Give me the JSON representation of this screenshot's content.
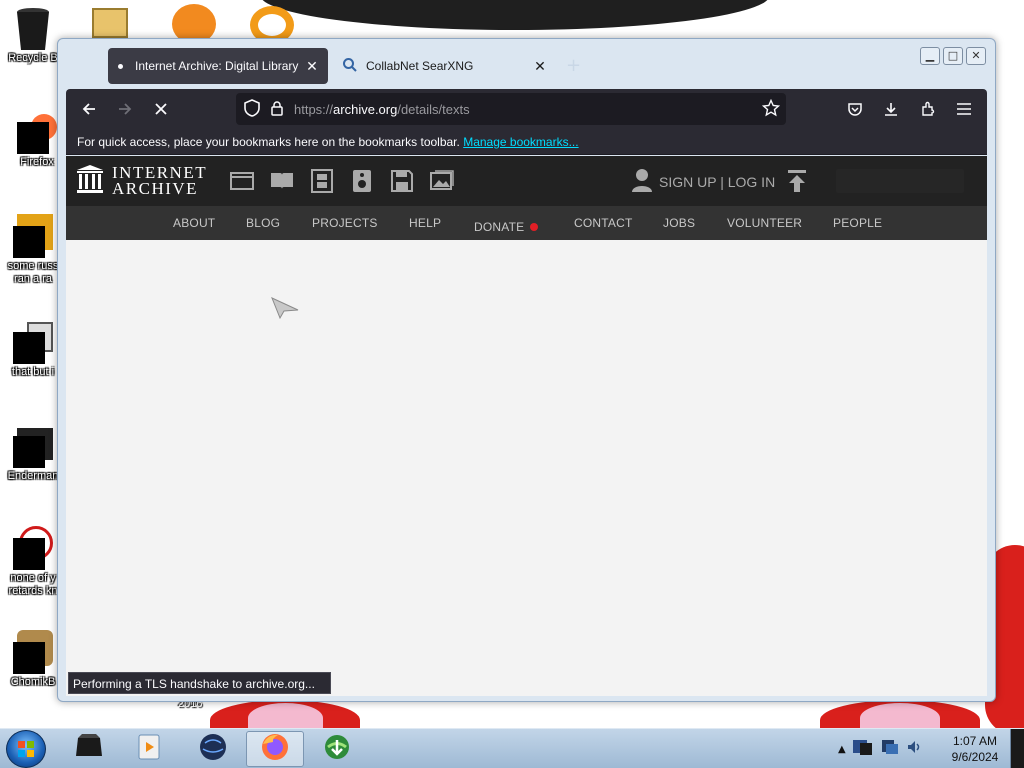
{
  "desktop": {
    "icons": [
      {
        "label": "Recycle B"
      },
      {
        "label": "Firefox"
      },
      {
        "label": "some russ\nran a ra"
      },
      {
        "label": "that but i"
      },
      {
        "label": "Enderman"
      },
      {
        "label": "none of y\nretards kn"
      },
      {
        "label": "ChomikB"
      }
    ],
    "bottom_text": "2016"
  },
  "tabs": [
    {
      "title": "Internet Archive: Digital Library",
      "active": true
    },
    {
      "title": "CollabNet SearXNG",
      "active": false
    }
  ],
  "toolbar": {
    "url_protocol": "https://",
    "url_host": "archive.org",
    "url_path": "/details/texts"
  },
  "bookmarks_bar": {
    "text": "For quick access, place your bookmarks here on the bookmarks toolbar.",
    "link": "Manage bookmarks..."
  },
  "ia": {
    "logo_line1": "INTERNET",
    "logo_line2": "ARCHIVE",
    "auth": "SIGN UP | LOG IN",
    "nav": [
      "ABOUT",
      "BLOG",
      "PROJECTS",
      "HELP",
      "DONATE",
      "CONTACT",
      "JOBS",
      "VOLUNTEER",
      "PEOPLE"
    ]
  },
  "status": "Performing a TLS handshake to archive.org...",
  "taskbar": {
    "time": "1:07 AM",
    "date": "9/6/2024"
  },
  "colors": {
    "accent_link": "#00ddff",
    "donate_heart": "#e21f26",
    "toolbar_bg": "#2b2a33"
  }
}
